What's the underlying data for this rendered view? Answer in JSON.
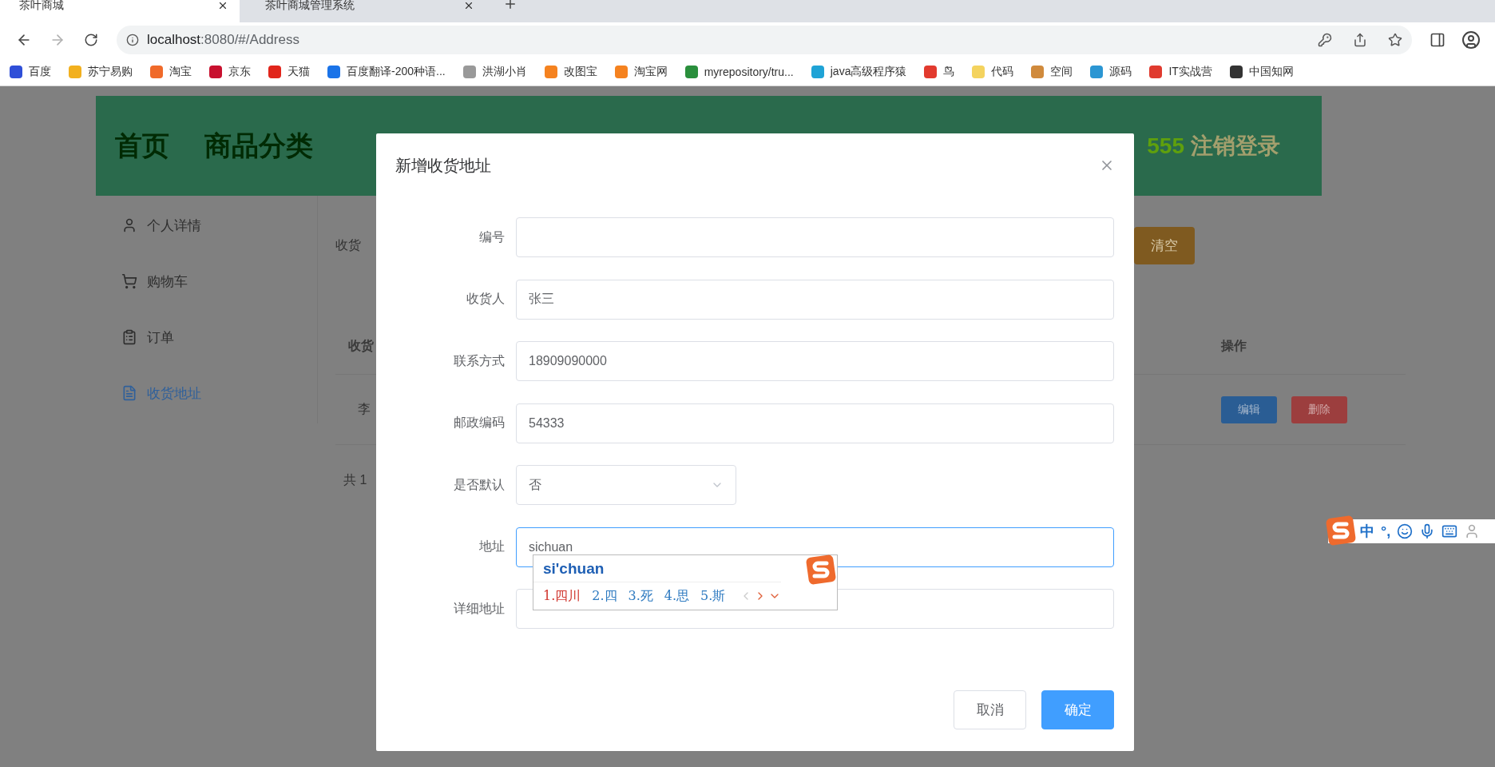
{
  "browser": {
    "tabs": [
      {
        "title": "茶叶商城",
        "selected": true
      },
      {
        "title": "茶叶商城管理系统",
        "selected": false
      }
    ],
    "url": {
      "host": "localhost",
      "rest": ":8080/#/Address"
    },
    "bookmarks": [
      "百度",
      "苏宁易购",
      "淘宝",
      "京东",
      "天猫",
      "百度翻译-200种语...",
      "洪湖小肖",
      "改图宝",
      "淘宝网",
      "myrepository/tru...",
      "java高级程序猿",
      "鸟",
      "代码",
      "空间",
      "源码",
      "IT实战营",
      "中国知网"
    ]
  },
  "header": {
    "nav": [
      "首页",
      "商品分类"
    ],
    "user": "555",
    "logout": "注销登录"
  },
  "sidebar": [
    {
      "label": "个人详情",
      "selected": false
    },
    {
      "label": "购物车",
      "selected": false
    },
    {
      "label": "订单",
      "selected": false
    },
    {
      "label": "收货地址",
      "selected": true
    }
  ],
  "content": {
    "search_label": "收货",
    "clear_button": "清空",
    "columns": [
      "收货",
      "操作"
    ],
    "rows": [
      {
        "column_1": "李",
        "actions": [
          "编辑",
          "删除"
        ]
      }
    ],
    "pagination": "共 1"
  },
  "dialog": {
    "title": "新增收货地址",
    "fields": [
      {
        "label": "编号",
        "kind": "input",
        "focused": false
      },
      {
        "label": "收货人",
        "kind": "input",
        "value": "张三",
        "focused": false
      },
      {
        "label": "联系方式",
        "kind": "input",
        "value": "18909090000",
        "focused": false
      },
      {
        "label": "邮政编码",
        "kind": "input",
        "value": "54333",
        "focused": false
      },
      {
        "label": "是否默认",
        "kind": "select",
        "value": "否",
        "focused": false
      },
      {
        "label": "地址",
        "kind": "input",
        "value": "sichuan",
        "focused": true
      },
      {
        "label": "详细地址",
        "kind": "input",
        "focused": false
      }
    ],
    "cancel": "取消",
    "confirm": "确定"
  },
  "ime": {
    "composition": "si'chuan",
    "candidates": [
      {
        "text": "1.四川",
        "selected": true
      },
      {
        "text": "2.四",
        "selected": false
      },
      {
        "text": "3.死",
        "selected": false
      },
      {
        "text": "4.思",
        "selected": false
      },
      {
        "text": "5.斯",
        "selected": false
      }
    ]
  },
  "ime_toolbar": {
    "mode": "中",
    "punctuation": "°,"
  }
}
